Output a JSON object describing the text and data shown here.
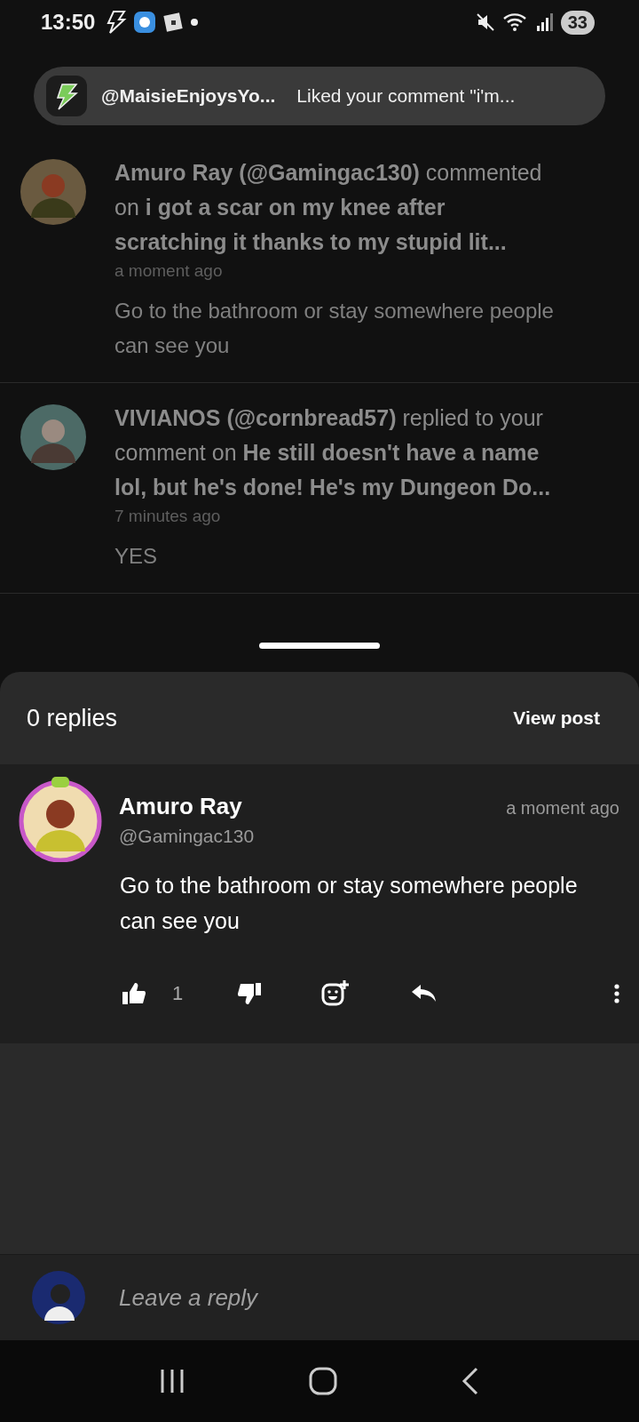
{
  "status_bar": {
    "time": "13:50",
    "battery": "33"
  },
  "toast": {
    "user": "@MaisieEnjoysYo...",
    "message": "Liked your comment \"i'm..."
  },
  "notifications": [
    {
      "text": "**Amuro Ray (@Gamingac130)** commented on **i got a scar on my knee after scratching it thanks to my stupid lit...**",
      "time": "a moment ago",
      "comment": "Go to the bathroom or stay somewhere people can see you"
    },
    {
      "text": "**VIVIANOS (@cornbread57)** replied to your comment on **He still doesn't have a name lol, but he's done! He's my Dungeon Do...**",
      "time": "7 minutes ago",
      "comment": "YES"
    }
  ],
  "sheet": {
    "title": "0 replies",
    "view_post": "View post",
    "comment": {
      "name": "Amuro Ray",
      "handle": "@Gamingac130",
      "time": "a moment ago",
      "text": "Go to the bathroom or stay somewhere people can see you",
      "likes": "1"
    },
    "reply_field": {
      "placeholder": "Leave a reply"
    }
  }
}
